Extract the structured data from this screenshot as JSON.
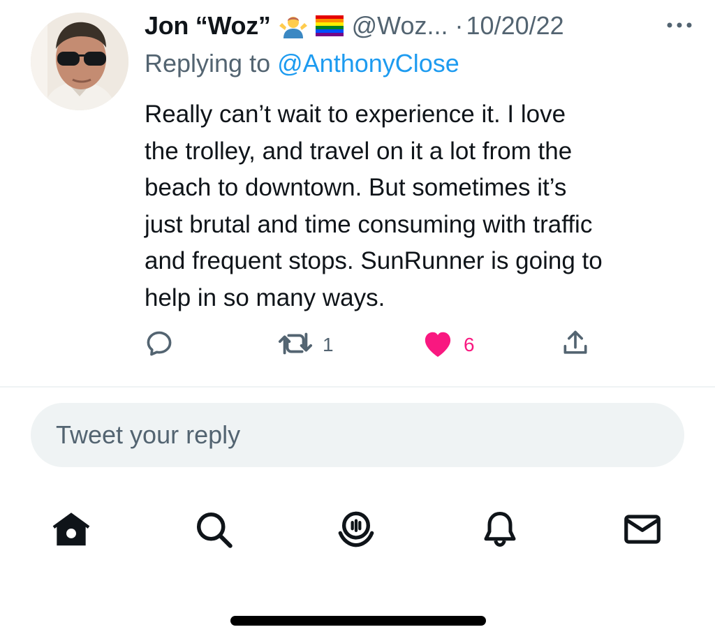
{
  "tweet": {
    "author": {
      "display_name": "Jon “Woz”",
      "handle": "@Woz...",
      "emoji": [
        "person-shrugging-emoji",
        "rainbow-flag-emoji"
      ]
    },
    "date": "10/20/22",
    "separator": "·",
    "replying_to_prefix": "Replying to",
    "replying_to_handle": "@AnthonyClose",
    "text": "Really can’t wait to experience it. I love\nthe trolley, and travel on it a lot from the\nbeach to downtown. But sometimes it’s\njust brutal and time consuming with traffic\nand frequent stops. SunRunner is going to\nhelp in so many ways.",
    "actions": {
      "reply": {
        "icon": "reply-icon",
        "count": ""
      },
      "retweet": {
        "icon": "retweet-icon",
        "count": "1"
      },
      "like": {
        "icon": "heart-icon",
        "count": "6",
        "liked": true
      },
      "share": {
        "icon": "share-icon"
      }
    }
  },
  "reply_box": {
    "placeholder": "Tweet your reply"
  },
  "nav": {
    "items": [
      "home-icon",
      "search-icon",
      "spaces-icon",
      "notifications-icon",
      "messages-icon"
    ],
    "active": "home-icon"
  },
  "colors": {
    "accent": "#1d9bf0",
    "like": "#f91880",
    "secondary_text": "#536471",
    "primary_text": "#0f1419",
    "reply_box_bg": "#eff3f4"
  }
}
